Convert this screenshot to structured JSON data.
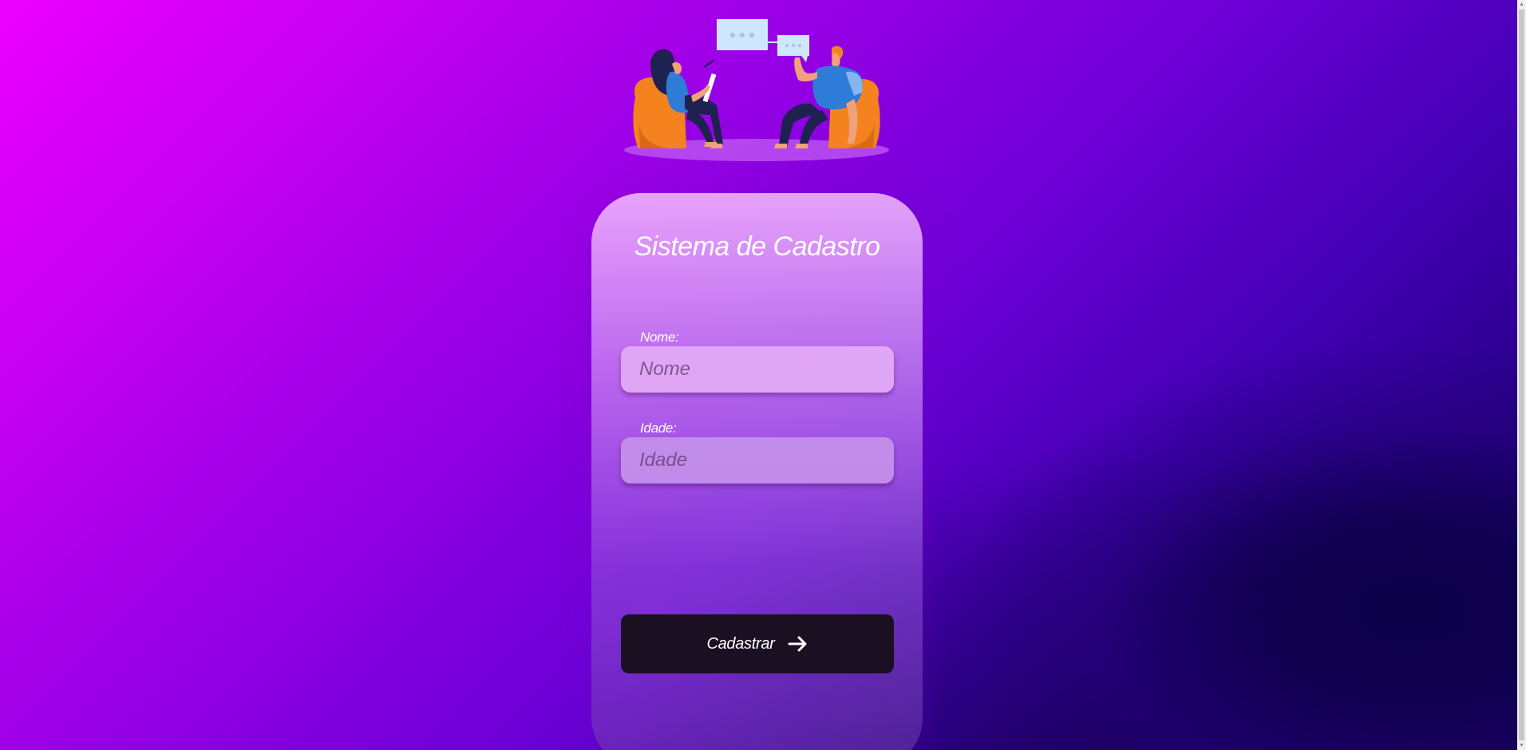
{
  "form": {
    "title": "Sistema de Cadastro",
    "nome_label": "Nome:",
    "nome_placeholder": "Nome",
    "nome_value": "",
    "idade_label": "Idade:",
    "idade_placeholder": "Idade",
    "idade_value": "",
    "submit_label": "Cadastrar",
    "submit_icon": "arrow-right-icon"
  },
  "illustration": {
    "name": "people-talking-illustration"
  },
  "colors": {
    "background_start": "#ec00ff",
    "background_end": "#14005a",
    "button_background": "#1a1022",
    "beanbag": "#f4831f",
    "text": "#ffffff"
  }
}
